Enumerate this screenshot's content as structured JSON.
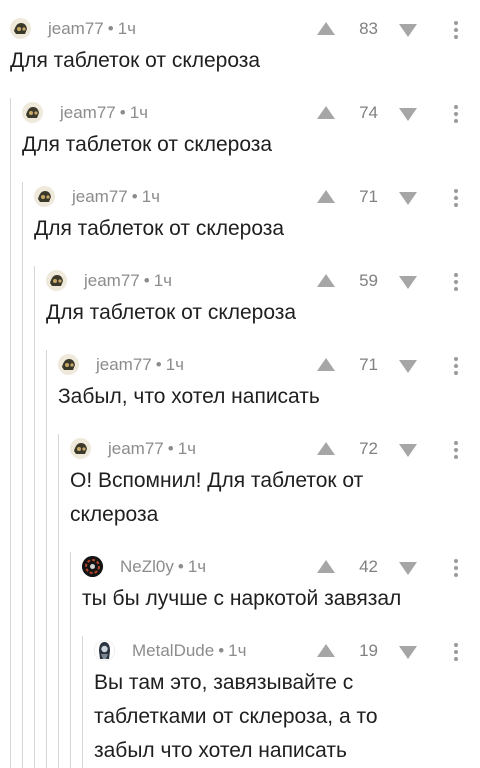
{
  "comments": [
    {
      "user": "jeam77",
      "time": "1ч",
      "score": "83",
      "text": "Для таблеток от склероза",
      "avatar": "jeam-avatar"
    },
    {
      "user": "jeam77",
      "time": "1ч",
      "score": "74",
      "text": "Для таблеток от склероза",
      "avatar": "jeam-avatar"
    },
    {
      "user": "jeam77",
      "time": "1ч",
      "score": "71",
      "text": "Для таблеток от склероза",
      "avatar": "jeam-avatar"
    },
    {
      "user": "jeam77",
      "time": "1ч",
      "score": "59",
      "text": "Для таблеток от склероза",
      "avatar": "jeam-avatar"
    },
    {
      "user": "jeam77",
      "time": "1ч",
      "score": "71",
      "text": "Забыл, что хотел написать",
      "avatar": "jeam-avatar"
    },
    {
      "user": "jeam77",
      "time": "1ч",
      "score": "72",
      "text": "О! Вспомнил! Для таблеток от склероза",
      "avatar": "jeam-avatar"
    },
    {
      "user": "NeZl0y",
      "time": "1ч",
      "score": "42",
      "text": "ты бы лучше с наркотой завязал",
      "avatar": "nezloy-avatar"
    },
    {
      "user": "MetalDude",
      "time": "1ч",
      "score": "19",
      "text": "Вы там это, завязывайте с таблетками от склероза, а то забыл что хотел написать",
      "avatar": "metaldude-avatar"
    }
  ],
  "meta_separator": "•",
  "icons": {
    "upvote": "upvote-icon",
    "downvote": "downvote-icon",
    "more": "more-options-icon"
  }
}
